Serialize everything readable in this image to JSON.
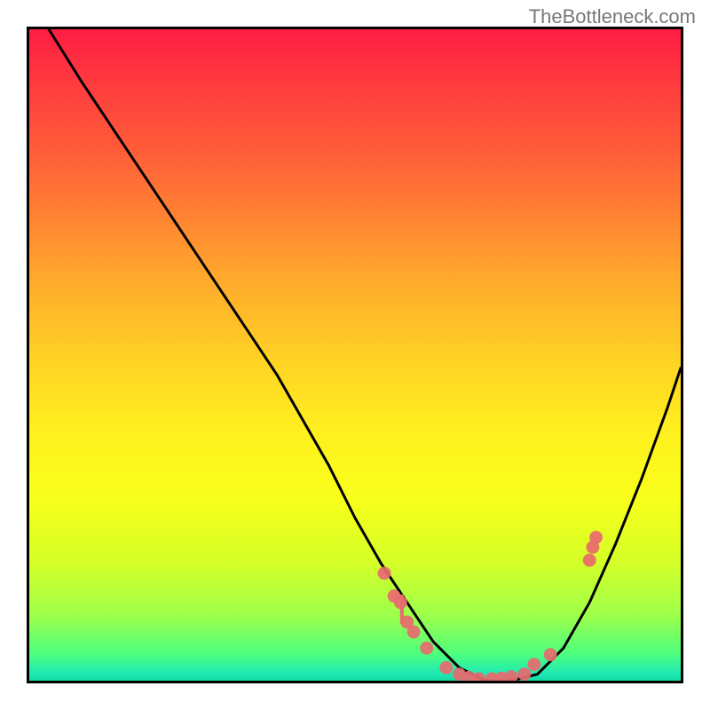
{
  "watermark": "TheBottleneck.com",
  "chart_data": {
    "type": "line",
    "title": "",
    "xlabel": "",
    "ylabel": "",
    "xlim": [
      0,
      100
    ],
    "ylim": [
      0,
      100
    ],
    "curve": {
      "name": "bottleneck-curve",
      "x": [
        3,
        8,
        14,
        20,
        26,
        32,
        38,
        42,
        46,
        50,
        54,
        58,
        62,
        66,
        70,
        74,
        78,
        82,
        86,
        90,
        94,
        98,
        100
      ],
      "y": [
        100,
        92,
        83,
        74,
        65,
        56,
        47,
        40,
        33,
        25,
        18,
        12,
        6,
        2,
        0,
        0,
        1,
        5,
        12,
        21,
        31,
        42,
        48
      ]
    },
    "scatter_points": [
      {
        "x": 54.5,
        "y": 16.5
      },
      {
        "x": 56.0,
        "y": 13.0
      },
      {
        "x": 57.0,
        "y": 12.0
      },
      {
        "x": 58.0,
        "y": 9.0
      },
      {
        "x": 59.0,
        "y": 7.5
      },
      {
        "x": 61.0,
        "y": 5.0
      },
      {
        "x": 64.0,
        "y": 2.0
      },
      {
        "x": 66.0,
        "y": 1.0
      },
      {
        "x": 67.5,
        "y": 0.5
      },
      {
        "x": 69.0,
        "y": 0.3
      },
      {
        "x": 71.0,
        "y": 0.3
      },
      {
        "x": 72.5,
        "y": 0.4
      },
      {
        "x": 74.0,
        "y": 0.6
      },
      {
        "x": 76.0,
        "y": 1.0
      },
      {
        "x": 77.5,
        "y": 2.5
      },
      {
        "x": 80.0,
        "y": 4.0
      },
      {
        "x": 86.0,
        "y": 18.5
      },
      {
        "x": 86.5,
        "y": 20.5
      },
      {
        "x": 87.0,
        "y": 22.0
      }
    ],
    "vertical_mark": {
      "x": 57.2,
      "y0": 9.0,
      "y1": 13.0
    },
    "colors": {
      "curve": "#000000",
      "point_fill": "#e86a6f",
      "point_stroke": "#e86a6f",
      "gradient_top": "#ff1d44",
      "gradient_bottom": "#13d89e"
    }
  }
}
